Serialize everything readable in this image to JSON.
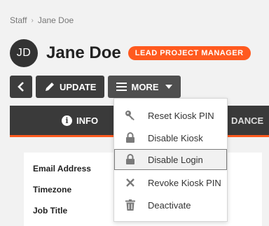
{
  "breadcrumb": {
    "parent": "Staff",
    "separator": "›",
    "current": "Jane Doe"
  },
  "profile": {
    "initials": "JD",
    "name": "Jane Doe",
    "role_badge": "LEAD PROJECT MANAGER"
  },
  "toolbar": {
    "update_label": "UPDATE",
    "more_label": "MORE"
  },
  "tabs": [
    {
      "label": "INFO",
      "active": true
    },
    {
      "label": "DANCE",
      "active": false
    }
  ],
  "info_fields": [
    {
      "label": "Email Address"
    },
    {
      "label": "Timezone"
    },
    {
      "label": "Job Title"
    }
  ],
  "more_menu": {
    "items": [
      {
        "label": "Reset Kiosk PIN",
        "icon": "key-icon"
      },
      {
        "label": "Disable Kiosk",
        "icon": "lock-icon"
      },
      {
        "label": "Disable Login",
        "icon": "lock-icon",
        "highlighted": true
      },
      {
        "label": "Revoke Kiosk PIN",
        "icon": "x-icon"
      },
      {
        "label": "Deactivate",
        "icon": "trash-icon"
      }
    ]
  },
  "colors": {
    "accent": "#ff5a1f",
    "dark_button": "#3d3d3d",
    "tab_bar": "#3a3a3a"
  }
}
